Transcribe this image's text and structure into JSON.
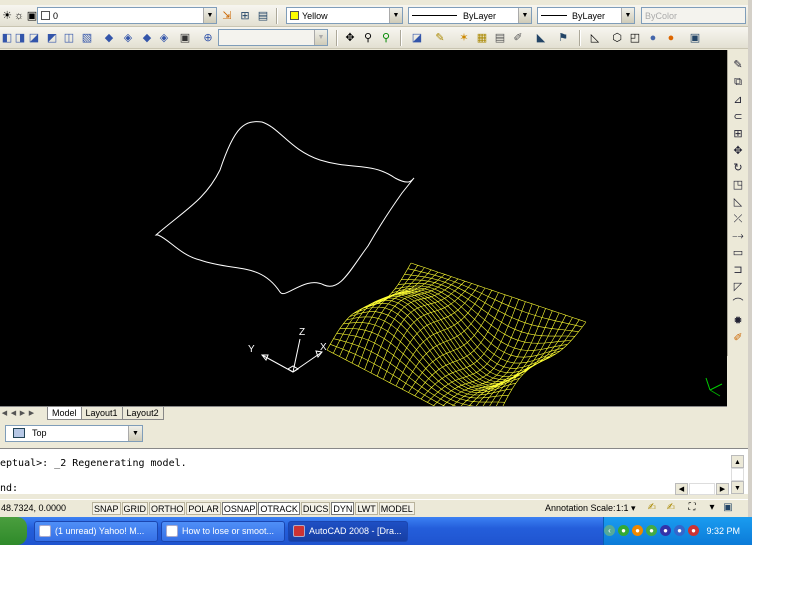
{
  "toolbar1": {
    "layer_value": "0",
    "color_value": "Yellow",
    "linetype_value": "ByLayer",
    "lineweight_value": "ByLayer",
    "plotstyle_value": "ByColor"
  },
  "viewport": {
    "ucs": {
      "y": "Y",
      "z": "Z",
      "x": "X"
    },
    "colors": {
      "background": "#000000",
      "mesh": "#ffff33",
      "outline": "#ffffff"
    }
  },
  "tabs": [
    "Model",
    "Layout1",
    "Layout2"
  ],
  "view_selector": {
    "value": "Top"
  },
  "command": {
    "history": "eptual>: _2 Regenerating model.",
    "prompt": "nd:"
  },
  "status": {
    "coords": "48.7324, 0.0000",
    "buttons": [
      "SNAP",
      "GRID",
      "ORTHO",
      "POLAR",
      "OSNAP",
      "OTRACK",
      "DUCS",
      "DYN",
      "LWT",
      "MODEL"
    ],
    "annotation_label": "Annotation Scale:",
    "annotation_value": "1:1 ▾"
  },
  "taskbar": {
    "items": [
      "(1 unread) Yahoo! M...",
      "How to lose or smoot...",
      "AutoCAD 2008 - [Dra..."
    ],
    "clock": "9:32 PM"
  }
}
